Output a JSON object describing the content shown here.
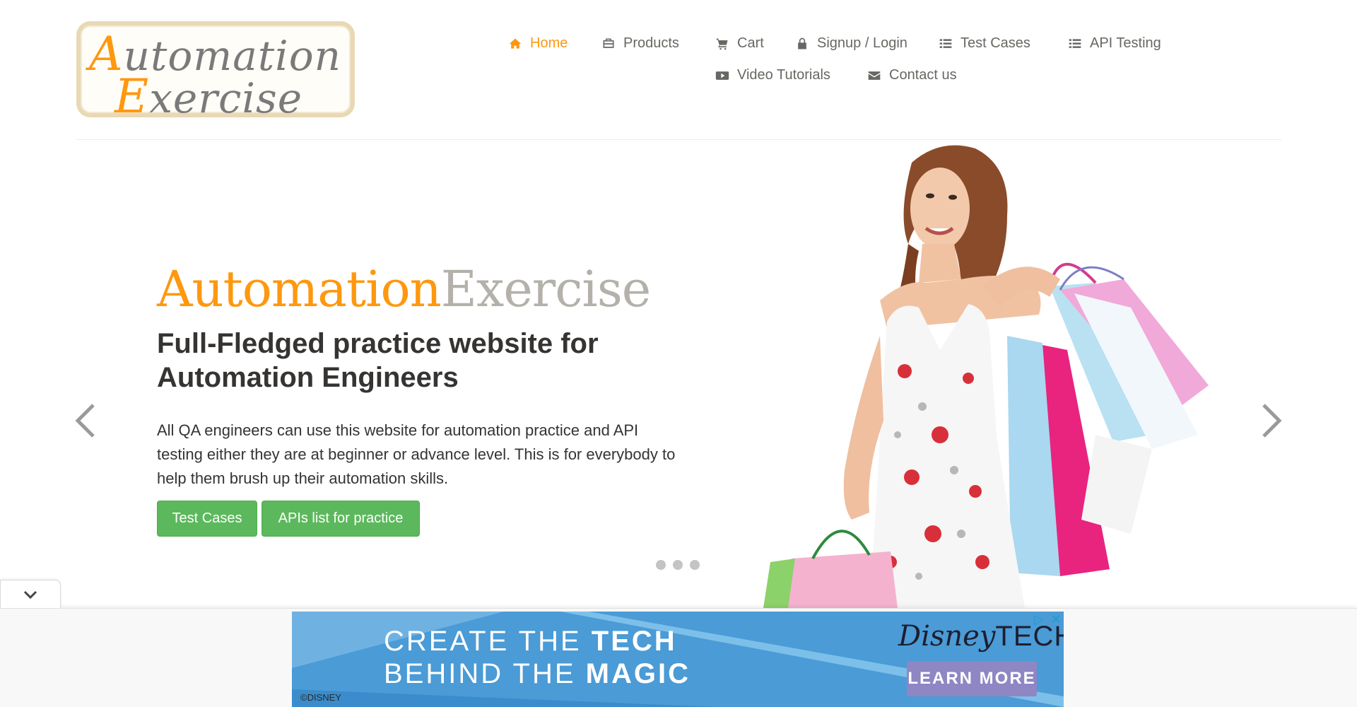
{
  "logo": {
    "line1_cap": "A",
    "line1_rest": "utomation",
    "line2_cap": "E",
    "line2_rest": "xercise"
  },
  "nav": {
    "items": [
      {
        "label": "Home",
        "icon": "home-icon",
        "active": true
      },
      {
        "label": "Products",
        "icon": "briefcase-icon"
      },
      {
        "label": "Cart",
        "icon": "shopping-cart-icon"
      },
      {
        "label": "Signup / Login",
        "icon": "lock-icon"
      },
      {
        "label": "Test Cases",
        "icon": "list-icon"
      },
      {
        "label": "API Testing",
        "icon": "list-icon"
      },
      {
        "label": "Video Tutorials",
        "icon": "youtube-play-icon"
      },
      {
        "label": "Contact us",
        "icon": "envelope-icon"
      }
    ],
    "active_color": "#fe980f"
  },
  "hero": {
    "brand_part1": "Automation",
    "brand_part2": "Exercise",
    "heading": "Full-Fledged practice website for Automation Engineers",
    "text": "All QA engineers can use this website for automation practice and API testing either they are at beginner or advance level. This is for everybody to help them brush up their automation skills.",
    "button_test_cases": "Test Cases",
    "button_apis": "APIs list for practice",
    "slide_count": 3,
    "button_color": "#5cb85c"
  },
  "ad": {
    "line1_light": "CREATE THE ",
    "line1_bold": "TECH",
    "line2_light": "BEHIND THE ",
    "line2_bold": "MAGIC",
    "brand_script": "Disney",
    "brand_tech": "TECH",
    "cta": "LEARN MORE",
    "copyright": "©DISNEY"
  }
}
